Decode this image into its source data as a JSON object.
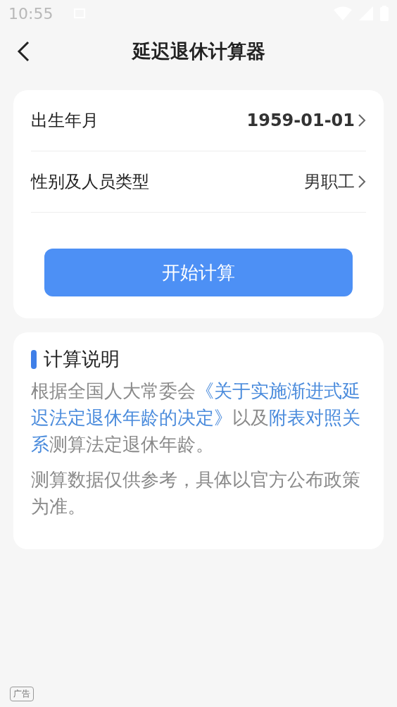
{
  "status_bar": {
    "time": "10:55"
  },
  "header": {
    "title": "延迟退休计算器"
  },
  "form": {
    "rows": [
      {
        "label": "出生年月",
        "value": "1959-01-01",
        "emphasis": true
      },
      {
        "label": "性别及人员类型",
        "value": "男职工",
        "emphasis": false
      }
    ],
    "button": "开始计算"
  },
  "info": {
    "title": "计算说明",
    "paragraphs": [
      [
        {
          "kind": "text",
          "text": "根据全国人大常委会"
        },
        {
          "kind": "link",
          "text": "《关于实施渐进式延"
        },
        {
          "kind": "link",
          "text": "迟法定退休年龄的决定》"
        },
        {
          "kind": "text",
          "text": "以及"
        },
        {
          "kind": "link",
          "text": "附表对照关"
        },
        {
          "kind": "link",
          "text": "系"
        },
        {
          "kind": "text",
          "text": "测算法定退休年龄。"
        }
      ],
      [
        {
          "kind": "text",
          "text": "测算数据仅供参考，具体以官方公布政策为准。"
        }
      ]
    ]
  },
  "ad_badge": "广告"
}
